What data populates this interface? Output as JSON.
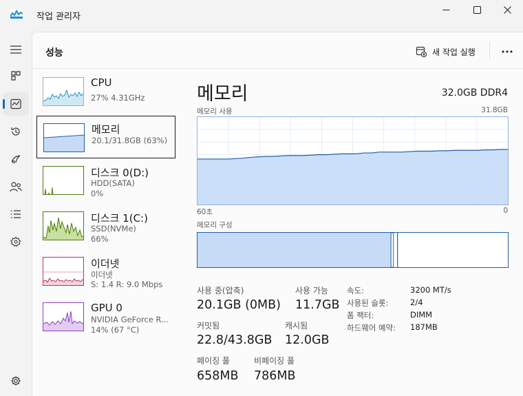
{
  "window": {
    "title": "작업 관리자"
  },
  "header": {
    "title": "성능",
    "new_task_label": "새 작업 실행"
  },
  "rail": {
    "items": [
      {
        "name": "hamburger-menu-icon"
      },
      {
        "name": "processes-icon"
      },
      {
        "name": "performance-icon",
        "active": true
      },
      {
        "name": "app-history-icon"
      },
      {
        "name": "startup-apps-icon"
      },
      {
        "name": "users-icon"
      },
      {
        "name": "details-icon"
      },
      {
        "name": "services-icon"
      },
      {
        "name": "settings-icon"
      }
    ]
  },
  "devices": [
    {
      "name": "CPU",
      "sub1": "27% 4.31GHz",
      "sub2": "",
      "color": "#1d8fc7"
    },
    {
      "name": "메모리",
      "sub1": "20.1/31.8GB (63%)",
      "sub2": "",
      "color": "#1d5fa8",
      "selected": true
    },
    {
      "name": "디스크 0(D:)",
      "sub1": "HDD(SATA)",
      "sub2": "0%",
      "color": "#4d7a11"
    },
    {
      "name": "디스크 1(C:)",
      "sub1": "SSD(NVMe)",
      "sub2": "66%",
      "color": "#4d7a11"
    },
    {
      "name": "이더넷",
      "sub1": "이더넷",
      "sub2": "S: 1.4 R: 9.0 Mbps",
      "color": "#b5365f"
    },
    {
      "name": "GPU 0",
      "sub1": "NVIDIA GeForce R...",
      "sub2": "14% (67 °C)",
      "color": "#8a3fc1"
    }
  ],
  "memory": {
    "title": "메모리",
    "spec": "32.0GB DDR4",
    "usage_label": "메모리 사용",
    "usage_max": "31.8GB",
    "time_start": "60초",
    "time_end": "0",
    "composition_label": "메모리 구성",
    "usage_history_fraction": [
      0.52,
      0.52,
      0.52,
      0.52,
      0.52,
      0.525,
      0.53,
      0.54,
      0.545,
      0.55,
      0.55,
      0.555,
      0.56,
      0.56,
      0.56,
      0.565,
      0.57,
      0.57,
      0.575,
      0.58,
      0.58,
      0.58,
      0.59,
      0.59,
      0.6,
      0.6,
      0.6,
      0.6,
      0.605,
      0.61,
      0.61,
      0.61,
      0.615,
      0.615,
      0.62,
      0.62,
      0.62,
      0.62,
      0.625,
      0.625,
      0.63,
      0.63
    ],
    "composition": {
      "in_use": 0.63,
      "modified": 0.008,
      "standby": 0.002
    },
    "stats": [
      {
        "label": "사용 중(압축)",
        "value": "20.1GB (0MB)"
      },
      {
        "label": "사용 가능",
        "value": "11.7GB"
      },
      {
        "label": "커밋됨",
        "value": "22.8/43.8GB"
      },
      {
        "label": "캐시됨",
        "value": "12.0GB"
      },
      {
        "label": "페이징 풀",
        "value": "658MB"
      },
      {
        "label": "비페이징 풀",
        "value": "786MB"
      }
    ],
    "details": [
      {
        "key": "속도:",
        "value": "3200 MT/s"
      },
      {
        "key": "사용된 슬롯:",
        "value": "2/4"
      },
      {
        "key": "폼 팩터:",
        "value": "DIMM"
      },
      {
        "key": "하드웨어 예약:",
        "value": "187MB"
      }
    ]
  },
  "colors": {
    "accent": "#0f6cbd",
    "memory_fill": "#c7dbf7",
    "memory_line": "#1d5fa8"
  }
}
